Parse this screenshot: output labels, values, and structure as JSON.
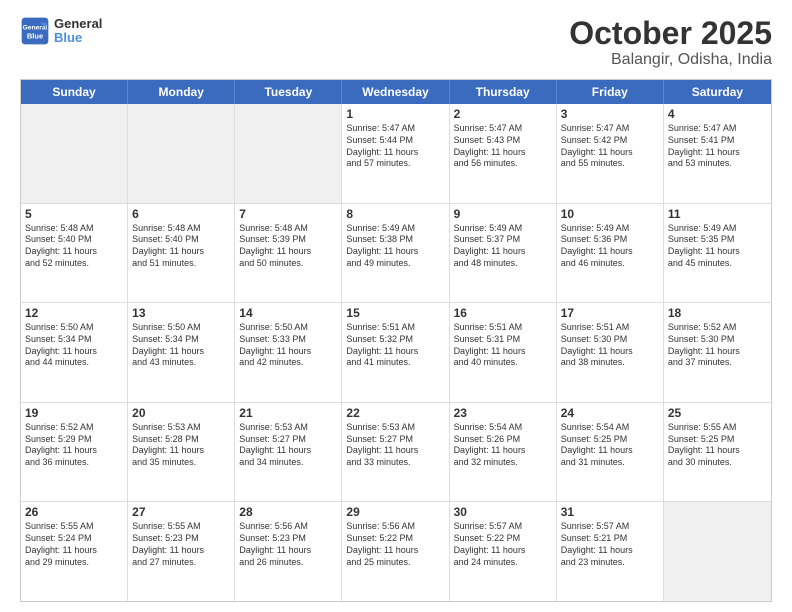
{
  "header": {
    "logo": {
      "line1": "General",
      "line2": "Blue"
    },
    "title": "October 2025",
    "subtitle": "Balangir, Odisha, India"
  },
  "weekdays": [
    "Sunday",
    "Monday",
    "Tuesday",
    "Wednesday",
    "Thursday",
    "Friday",
    "Saturday"
  ],
  "rows": [
    [
      {
        "day": "",
        "text": ""
      },
      {
        "day": "",
        "text": ""
      },
      {
        "day": "",
        "text": ""
      },
      {
        "day": "1",
        "text": "Sunrise: 5:47 AM\nSunset: 5:44 PM\nDaylight: 11 hours\nand 57 minutes."
      },
      {
        "day": "2",
        "text": "Sunrise: 5:47 AM\nSunset: 5:43 PM\nDaylight: 11 hours\nand 56 minutes."
      },
      {
        "day": "3",
        "text": "Sunrise: 5:47 AM\nSunset: 5:42 PM\nDaylight: 11 hours\nand 55 minutes."
      },
      {
        "day": "4",
        "text": "Sunrise: 5:47 AM\nSunset: 5:41 PM\nDaylight: 11 hours\nand 53 minutes."
      }
    ],
    [
      {
        "day": "5",
        "text": "Sunrise: 5:48 AM\nSunset: 5:40 PM\nDaylight: 11 hours\nand 52 minutes."
      },
      {
        "day": "6",
        "text": "Sunrise: 5:48 AM\nSunset: 5:40 PM\nDaylight: 11 hours\nand 51 minutes."
      },
      {
        "day": "7",
        "text": "Sunrise: 5:48 AM\nSunset: 5:39 PM\nDaylight: 11 hours\nand 50 minutes."
      },
      {
        "day": "8",
        "text": "Sunrise: 5:49 AM\nSunset: 5:38 PM\nDaylight: 11 hours\nand 49 minutes."
      },
      {
        "day": "9",
        "text": "Sunrise: 5:49 AM\nSunset: 5:37 PM\nDaylight: 11 hours\nand 48 minutes."
      },
      {
        "day": "10",
        "text": "Sunrise: 5:49 AM\nSunset: 5:36 PM\nDaylight: 11 hours\nand 46 minutes."
      },
      {
        "day": "11",
        "text": "Sunrise: 5:49 AM\nSunset: 5:35 PM\nDaylight: 11 hours\nand 45 minutes."
      }
    ],
    [
      {
        "day": "12",
        "text": "Sunrise: 5:50 AM\nSunset: 5:34 PM\nDaylight: 11 hours\nand 44 minutes."
      },
      {
        "day": "13",
        "text": "Sunrise: 5:50 AM\nSunset: 5:34 PM\nDaylight: 11 hours\nand 43 minutes."
      },
      {
        "day": "14",
        "text": "Sunrise: 5:50 AM\nSunset: 5:33 PM\nDaylight: 11 hours\nand 42 minutes."
      },
      {
        "day": "15",
        "text": "Sunrise: 5:51 AM\nSunset: 5:32 PM\nDaylight: 11 hours\nand 41 minutes."
      },
      {
        "day": "16",
        "text": "Sunrise: 5:51 AM\nSunset: 5:31 PM\nDaylight: 11 hours\nand 40 minutes."
      },
      {
        "day": "17",
        "text": "Sunrise: 5:51 AM\nSunset: 5:30 PM\nDaylight: 11 hours\nand 38 minutes."
      },
      {
        "day": "18",
        "text": "Sunrise: 5:52 AM\nSunset: 5:30 PM\nDaylight: 11 hours\nand 37 minutes."
      }
    ],
    [
      {
        "day": "19",
        "text": "Sunrise: 5:52 AM\nSunset: 5:29 PM\nDaylight: 11 hours\nand 36 minutes."
      },
      {
        "day": "20",
        "text": "Sunrise: 5:53 AM\nSunset: 5:28 PM\nDaylight: 11 hours\nand 35 minutes."
      },
      {
        "day": "21",
        "text": "Sunrise: 5:53 AM\nSunset: 5:27 PM\nDaylight: 11 hours\nand 34 minutes."
      },
      {
        "day": "22",
        "text": "Sunrise: 5:53 AM\nSunset: 5:27 PM\nDaylight: 11 hours\nand 33 minutes."
      },
      {
        "day": "23",
        "text": "Sunrise: 5:54 AM\nSunset: 5:26 PM\nDaylight: 11 hours\nand 32 minutes."
      },
      {
        "day": "24",
        "text": "Sunrise: 5:54 AM\nSunset: 5:25 PM\nDaylight: 11 hours\nand 31 minutes."
      },
      {
        "day": "25",
        "text": "Sunrise: 5:55 AM\nSunset: 5:25 PM\nDaylight: 11 hours\nand 30 minutes."
      }
    ],
    [
      {
        "day": "26",
        "text": "Sunrise: 5:55 AM\nSunset: 5:24 PM\nDaylight: 11 hours\nand 29 minutes."
      },
      {
        "day": "27",
        "text": "Sunrise: 5:55 AM\nSunset: 5:23 PM\nDaylight: 11 hours\nand 27 minutes."
      },
      {
        "day": "28",
        "text": "Sunrise: 5:56 AM\nSunset: 5:23 PM\nDaylight: 11 hours\nand 26 minutes."
      },
      {
        "day": "29",
        "text": "Sunrise: 5:56 AM\nSunset: 5:22 PM\nDaylight: 11 hours\nand 25 minutes."
      },
      {
        "day": "30",
        "text": "Sunrise: 5:57 AM\nSunset: 5:22 PM\nDaylight: 11 hours\nand 24 minutes."
      },
      {
        "day": "31",
        "text": "Sunrise: 5:57 AM\nSunset: 5:21 PM\nDaylight: 11 hours\nand 23 minutes."
      },
      {
        "day": "",
        "text": ""
      }
    ]
  ]
}
